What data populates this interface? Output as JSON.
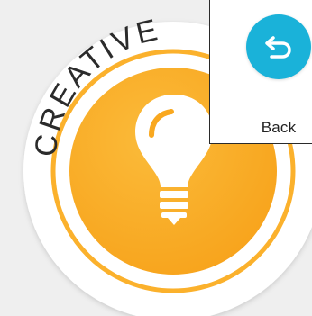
{
  "badge": {
    "label": "CREATIVE",
    "icon": "lightbulb-icon",
    "colors": {
      "disc": "#ffffff",
      "ring": "#fbb12c",
      "center": "#f9a81f",
      "bulb": "#ffffff"
    }
  },
  "back_button": {
    "label": "Back",
    "icon": "undo-arrow-icon",
    "color": "#1ab2d9"
  }
}
